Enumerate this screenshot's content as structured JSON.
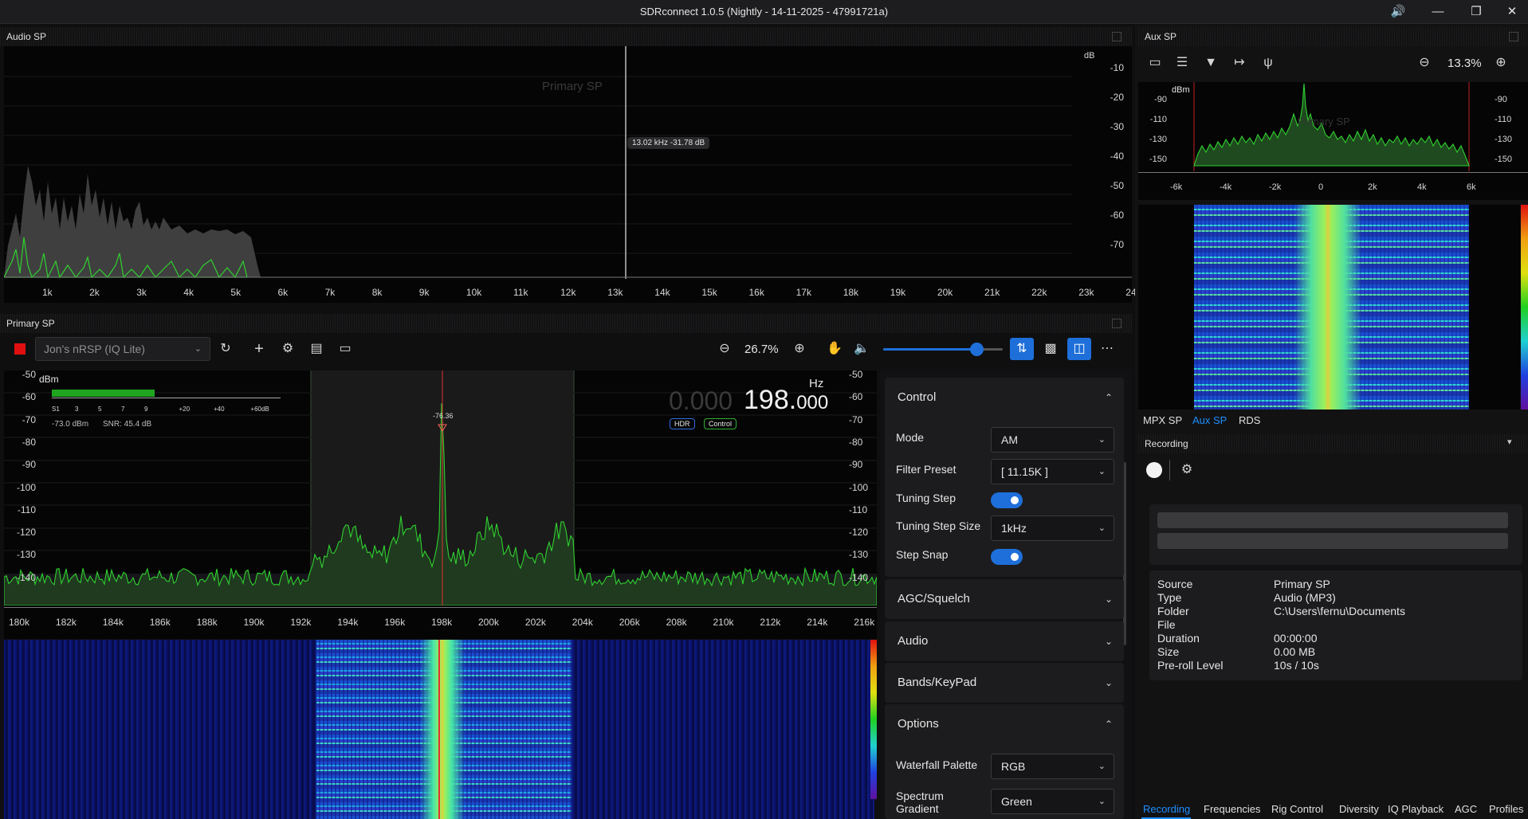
{
  "window": {
    "title": "SDRconnect 1.0.5 (Nightly - 14-11-2025 - 47991721a)"
  },
  "audio_sp": {
    "title": "Audio SP",
    "watermark": "Primary SP",
    "unit": "dB",
    "cursor_readout": "13.02 kHz -31.78 dB",
    "y_ticks": [
      "-10",
      "-20",
      "-30",
      "-40",
      "-50",
      "-60",
      "-70"
    ],
    "x_ticks": [
      "1k",
      "2k",
      "3k",
      "4k",
      "5k",
      "6k",
      "7k",
      "8k",
      "9k",
      "10k",
      "11k",
      "12k",
      "13k",
      "14k",
      "15k",
      "16k",
      "17k",
      "18k",
      "19k",
      "20k",
      "21k",
      "22k",
      "23k",
      "24"
    ]
  },
  "primary_sp": {
    "title": "Primary SP",
    "device": "Jon's nRSP (IQ Lite)",
    "zoom": "26.7%",
    "volume_fraction": 0.78,
    "unit": "dBm",
    "smeter_labels": [
      "S1",
      "3",
      "5",
      "7",
      "9",
      "+20",
      "+40",
      "+60dB"
    ],
    "smeter_level_fraction": 0.45,
    "signal_dbm": "-73.0 dBm",
    "snr": "SNR:  45.4 dB",
    "peak_label": "-76.36",
    "freq_dim": "0.000",
    "freq_main": "198.",
    "freq_small": "000",
    "freq_unit": "Hz",
    "hdr_badge": "HDR",
    "control_badge": "Control",
    "y_ticks": [
      "-50",
      "-60",
      "-70",
      "-80",
      "-90",
      "-100",
      "-110",
      "-120",
      "-130",
      "-140"
    ],
    "x_ticks": [
      "180k",
      "182k",
      "184k",
      "186k",
      "188k",
      "190k",
      "192k",
      "194k",
      "196k",
      "198k",
      "200k",
      "202k",
      "204k",
      "206k",
      "208k",
      "210k",
      "212k",
      "214k",
      "216k"
    ]
  },
  "control_panel": {
    "control": {
      "title": "Control",
      "chevron": "up-chevron-icon"
    },
    "mode_label": "Mode",
    "mode_value": "AM",
    "filter_label": "Filter Preset",
    "filter_value": "[ 11.15K ]",
    "tuning_step_label": "Tuning Step",
    "tuning_step_size_label": "Tuning Step Size",
    "tuning_step_size_value": "1kHz",
    "step_snap_label": "Step Snap",
    "agc": "AGC/Squelch",
    "audio": "Audio",
    "bands": "Bands/KeyPad",
    "options": "Options",
    "waterfall_palette_label": "Waterfall Palette",
    "waterfall_palette_value": "RGB",
    "spectrum_gradient_label_1": "Spectrum",
    "spectrum_gradient_label_2": "Gradient",
    "spectrum_gradient_value": "Green"
  },
  "aux_sp": {
    "title": "Aux SP",
    "zoom": "13.3%",
    "unit": "dBm",
    "watermark": "Primary SP",
    "y_ticks": [
      "-90",
      "-110",
      "-130",
      "-150"
    ],
    "x_ticks": [
      "-6k",
      "-4k",
      "-2k",
      "0",
      "2k",
      "4k",
      "6k"
    ],
    "tabs": [
      "MPX SP",
      "Aux SP",
      "RDS"
    ],
    "active_tab": "Aux SP"
  },
  "recording": {
    "title": "Recording",
    "info": [
      {
        "key": "Source",
        "value": "Primary SP"
      },
      {
        "key": "Type",
        "value": "Audio (MP3)"
      },
      {
        "key": "Folder",
        "value": "C:\\Users\\fernu\\Documents"
      },
      {
        "key": "File",
        "value": ""
      },
      {
        "key": "Duration",
        "value": "00:00:00"
      },
      {
        "key": "Size",
        "value": "0.00 MB"
      },
      {
        "key": "Pre-roll Level",
        "value": "10s / 10s"
      }
    ]
  },
  "bottom_tabs": [
    "Recording",
    "Frequencies",
    "Rig Control",
    "Diversity",
    "IQ Playback",
    "AGC",
    "Profiles"
  ],
  "colors": {
    "accent": "#1e6fd9",
    "spectrum": "#2fd12f",
    "tuning_line": "#e03030",
    "record": "#e01010"
  }
}
